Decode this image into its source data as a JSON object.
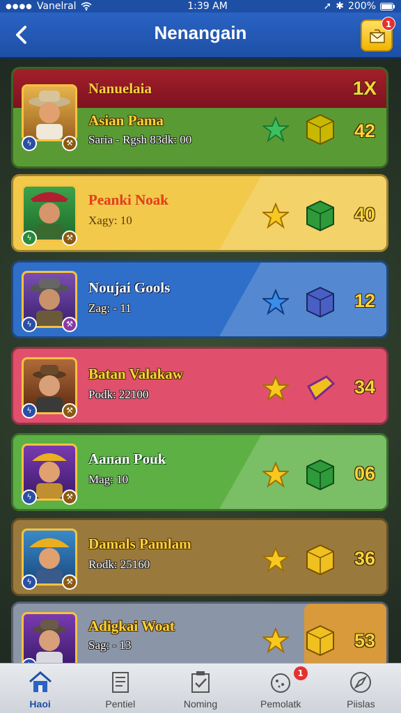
{
  "status_bar": {
    "carrier": "Vanelral",
    "time": "1:39 AM",
    "battery": "200%"
  },
  "header": {
    "title": "Nenangain",
    "notification_count": "1"
  },
  "cards": [
    {
      "name": "Asian Pama",
      "sub": "Saria - Rgsh 83dk: 00",
      "score": "42",
      "header_title": "Nanuelaia",
      "multiplier": "1X",
      "bg": "#5a9a35",
      "gem_color": "#c9b800"
    },
    {
      "name": "Peanki Noak",
      "sub": "Xagy: 10",
      "score": "40",
      "bg": "#f2c94a",
      "gem_color": "#2e9a3a"
    },
    {
      "name": "Noujai Gools",
      "sub": "Zag: - 11",
      "score": "12",
      "bg": "#2f6fc9",
      "gem_color": "#4a5fc4"
    },
    {
      "name": "Batan Valakaw",
      "sub": "Podk: 22100",
      "score": "34",
      "bg": "#e0506c",
      "gem_color": "#f0c020"
    },
    {
      "name": "Aanan Pouk",
      "sub": "Mag: 10",
      "score": "06",
      "bg": "#5db044",
      "gem_color": "#2e9a3a"
    },
    {
      "name": "Damals Pamlam",
      "sub": "Rodk: 25160",
      "score": "36",
      "bg": "#9a7a3c",
      "gem_color": "#f0c020"
    },
    {
      "name": "Adigkai Woat",
      "sub": "Sag: - 13",
      "score": "53",
      "bg": "#8b95a8",
      "gem_color": "#e8a820"
    }
  ],
  "tabs": [
    {
      "label": "Haoi",
      "icon": "home-icon"
    },
    {
      "label": "Pentiel",
      "icon": "document-icon"
    },
    {
      "label": "Noming",
      "icon": "checklist-icon"
    },
    {
      "label": "Pemolatk",
      "icon": "achievement-icon",
      "badge": "1"
    },
    {
      "label": "Piislas",
      "icon": "compass-icon"
    }
  ],
  "colors": {
    "header_blue": "#1d4fa5",
    "gold": "#f9d43b",
    "badge_red": "#e53030"
  }
}
